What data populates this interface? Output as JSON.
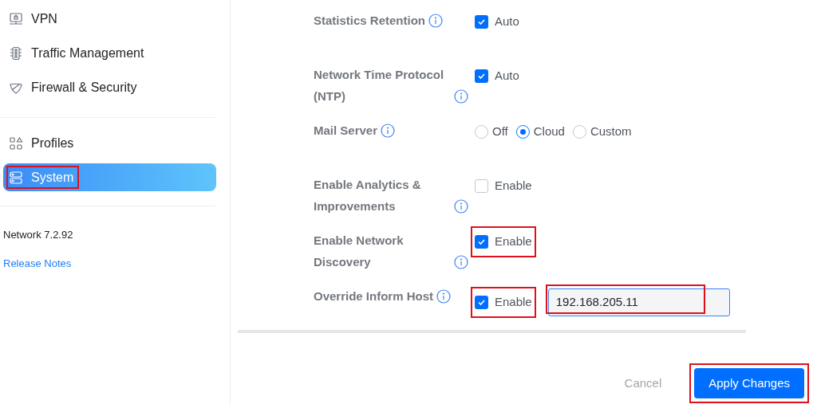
{
  "sidebar": {
    "items": [
      {
        "label": "VPN",
        "selected": false,
        "highlighted": false
      },
      {
        "label": "Traffic Management",
        "selected": false,
        "highlighted": false
      },
      {
        "label": "Firewall & Security",
        "selected": false,
        "highlighted": false
      },
      {
        "label": "Profiles",
        "selected": false,
        "highlighted": false
      },
      {
        "label": "System",
        "selected": true,
        "highlighted": true
      }
    ],
    "version": "Network 7.2.92",
    "release_notes": "Release Notes"
  },
  "settings": [
    {
      "label": "Statistics Retention",
      "kind": "checkbox",
      "checked": true,
      "text": "Auto",
      "highlighted": false
    },
    {
      "label": "Network Time Protocol (NTP)",
      "kind": "checkbox",
      "checked": true,
      "text": "Auto",
      "highlighted": false
    },
    {
      "label": "Mail Server",
      "kind": "radio",
      "options": [
        {
          "text": "Off",
          "selected": false
        },
        {
          "text": "Cloud",
          "selected": true
        },
        {
          "text": "Custom",
          "selected": false
        }
      ]
    },
    {
      "label": "Enable Analytics & Improvements",
      "kind": "checkbox",
      "checked": false,
      "text": "Enable",
      "highlighted": false
    },
    {
      "label": "Enable Network Discovery",
      "kind": "checkbox",
      "checked": true,
      "text": "Enable",
      "highlighted": true
    },
    {
      "label": "Override Inform Host",
      "kind": "checkbox_input",
      "checked": true,
      "text": "Enable",
      "highlighted": true,
      "field": {
        "value": "192.168.205.11",
        "highlighted": true
      }
    }
  ],
  "footer": {
    "cancel": "Cancel",
    "apply": {
      "label": "Apply Changes",
      "highlighted": true
    }
  }
}
